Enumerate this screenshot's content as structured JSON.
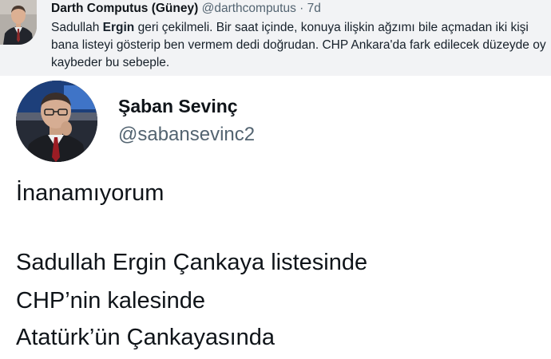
{
  "reply": {
    "display_name": "Darth Computus (Güney)",
    "handle": "@darthcomputus",
    "separator": "·",
    "time": "7d",
    "text_before": "Sadullah ",
    "text_bold": "Ergin",
    "text_after": " geri çekilmeli. Bir saat içinde, konuya ilişkin ağzımı bile açmadan iki kişi bana listeyi gösterip ben vermem dedi doğrudan. CHP Ankara'da fark edilecek düzeyde oy kaybeder bu sebeple."
  },
  "quote": {
    "display_name": "Şaban Sevinç",
    "handle": "@sabansevinc2",
    "lines": [
      "İnanamıyorum",
      "Sadullah Ergin Çankaya listesinde",
      "CHP’nin kalesinde",
      "Atatürk’ün Çankayasında"
    ]
  }
}
